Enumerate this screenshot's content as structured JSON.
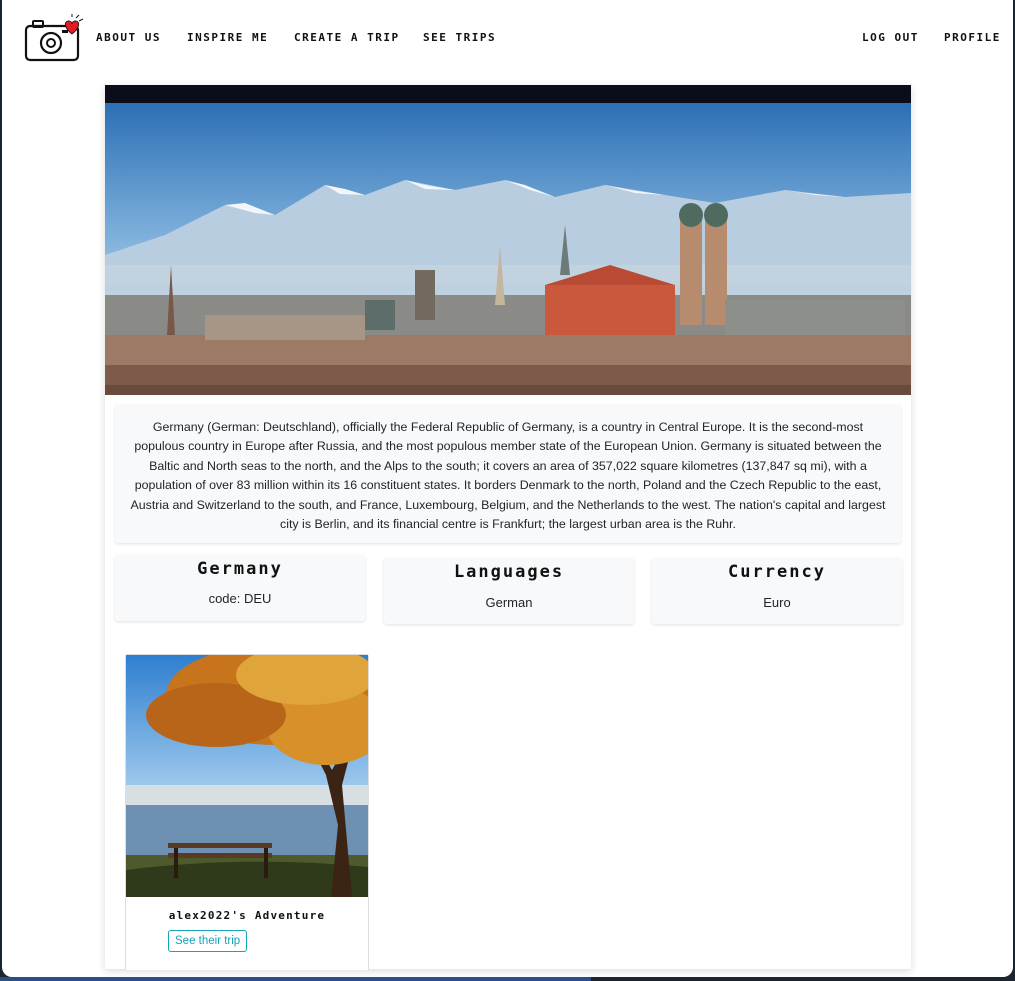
{
  "nav": {
    "links": [
      "ABOUT US",
      "INSPIRE ME",
      "CREATE A TRIP",
      "SEE TRIPS"
    ],
    "logout": "LOG OUT",
    "profile": "PROFILE"
  },
  "country": {
    "description": "Germany (German: Deutschland), officially the Federal Republic of Germany, is a country in Central Europe. It is the second-most populous country in Europe after Russia, and the most populous member state of the European Union. Germany is situated between the Baltic and North seas to the north, and the Alps to the south; it covers an area of 357,022 square kilometres (137,847 sq mi), with a population of over 83 million within its 16 constituent states. It borders Denmark to the north, Poland and the Czech Republic to the east, Austria and Switzerland to the south, and France, Luxembourg, Belgium, and the Netherlands to the west. The nation's capital and largest city is Berlin, and its financial centre is Frankfurt; the largest urban area is the Ruhr.",
    "name": "Germany",
    "code": "code: DEU",
    "languages_title": "Languages",
    "languages": "German",
    "currency_title": "Currency",
    "currency": "Euro"
  },
  "trips": [
    {
      "title": "alex2022's Adventure",
      "button": "See their trip"
    }
  ],
  "colors": {
    "accent": "#17a2b8",
    "heart": "#e31b23"
  },
  "icons": {
    "logo": "camera-heart-icon"
  }
}
